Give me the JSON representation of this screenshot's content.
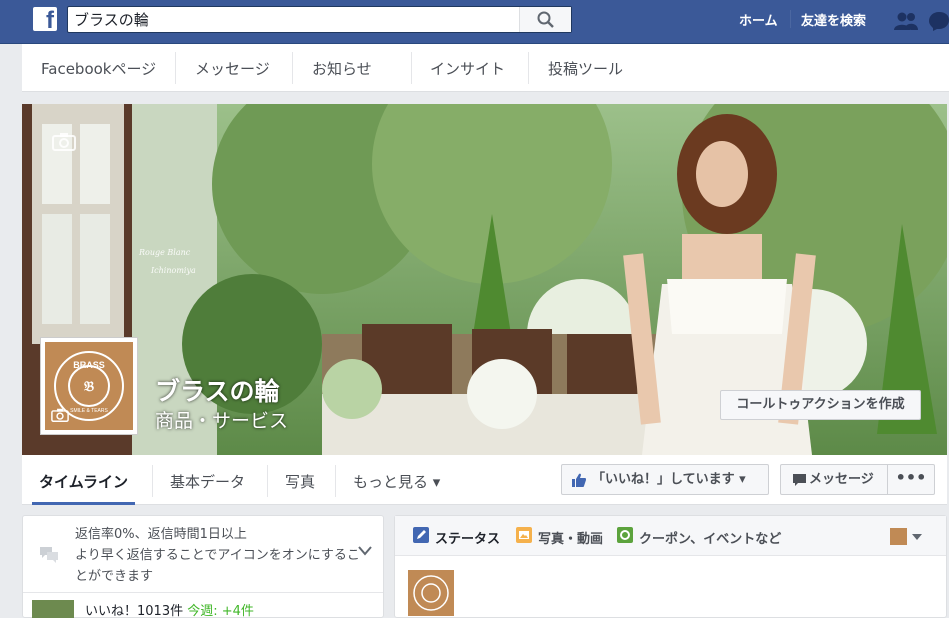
{
  "topbar": {
    "search_value": "ブラスの輪",
    "links": {
      "home": "ホーム",
      "find_friends": "友達を検索"
    }
  },
  "admin_tabs": [
    "Facebookページ",
    "メッセージ",
    "お知らせ",
    "インサイト",
    "投稿ツール"
  ],
  "cover": {
    "page_name": "ブラスの輪",
    "category": "商品・サービス",
    "cta_label": "コールトゥアクションを作成",
    "watermark_line1": "Rouge Blanc",
    "watermark_line2": "Ichinomiya",
    "logo_text": "BRASS",
    "logo_sub": "SMILE & TEARS"
  },
  "timeline_nav": {
    "tabs": [
      "タイムライン",
      "基本データ",
      "写真",
      "もっと見る ▾"
    ],
    "like_label": "「いいね！」しています ▾",
    "message_label": "メッセージ",
    "more_label": "•••"
  },
  "left_card": {
    "response_rate": "返信率0%、返信時間1日以上",
    "response_hint": "より早く返信することでアイコンをオンにすることができます",
    "likes_prefix": "いいね！1013件 ",
    "likes_week_label": "今週: +4件"
  },
  "composer": {
    "tabs": [
      "ステータス",
      "写真・動画",
      "クーポン、イベントなど"
    ]
  },
  "colors": {
    "facebook_blue": "#3b5998",
    "accent_blue": "#4267b2",
    "brand_brown": "#c08a55",
    "positive_green": "#42b72a"
  }
}
